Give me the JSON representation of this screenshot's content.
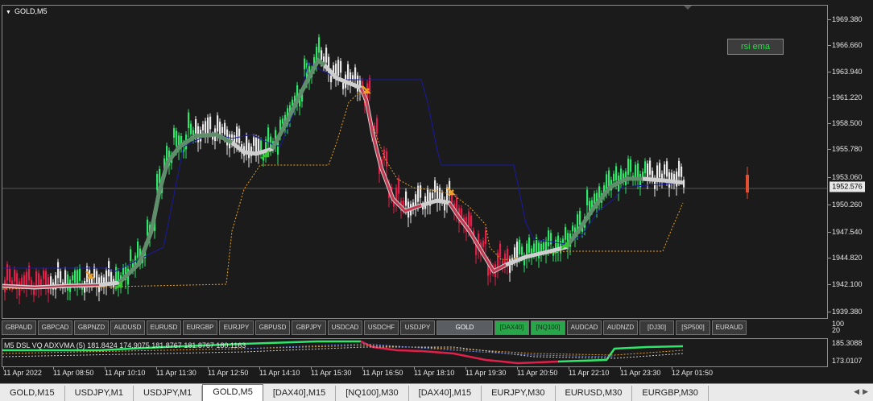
{
  "chart": {
    "title": "GOLD,M5",
    "collapse_icon": "triangle-down-icon",
    "current_price": "1952.576",
    "price_axis": [
      "1969.380",
      "1966.660",
      "1963.940",
      "1961.220",
      "1958.500",
      "1955.780",
      "1953.060",
      "1950.260",
      "1947.540",
      "1944.820",
      "1942.100",
      "1939.380"
    ],
    "rsi_ema_button": "rsi ema"
  },
  "symbols": [
    {
      "label": "GBPAUD",
      "state": "normal"
    },
    {
      "label": "GBPCAD",
      "state": "normal"
    },
    {
      "label": "GBPNZD",
      "state": "normal"
    },
    {
      "label": "AUDUSD",
      "state": "normal"
    },
    {
      "label": "EURUSD",
      "state": "normal"
    },
    {
      "label": "EURGBP",
      "state": "normal"
    },
    {
      "label": "EURJPY",
      "state": "normal"
    },
    {
      "label": "GBPUSD",
      "state": "normal"
    },
    {
      "label": "GBPJPY",
      "state": "normal"
    },
    {
      "label": "USDCAD",
      "state": "normal"
    },
    {
      "label": "USDCHF",
      "state": "normal"
    },
    {
      "label": "USDJPY",
      "state": "normal"
    },
    {
      "label": "GOLD",
      "state": "current"
    },
    {
      "label": "[DAX40]",
      "state": "green"
    },
    {
      "label": "[NQ100]",
      "state": "green"
    },
    {
      "label": "AUDCAD",
      "state": "normal"
    },
    {
      "label": "AUDNZD",
      "state": "normal"
    },
    {
      "label": "[DJ30]",
      "state": "normal"
    },
    {
      "label": "[SP500]",
      "state": "normal"
    },
    {
      "label": "EURAUD",
      "state": "normal"
    }
  ],
  "indicator": {
    "label": "M5 DSL  VQ  ADXVMA (5)   181.8424 174.9075 181.8767 181.8767 180.1163",
    "axis_top": [
      "100",
      "20"
    ],
    "axis": [
      "185.3088",
      "173.0107"
    ]
  },
  "time_axis": [
    "11 Apr 2022",
    "11 Apr 08:50",
    "11 Apr 10:10",
    "11 Apr 11:30",
    "11 Apr 12:50",
    "11 Apr 14:10",
    "11 Apr 15:30",
    "11 Apr 16:50",
    "11 Apr 18:10",
    "11 Apr 19:30",
    "11 Apr 20:50",
    "11 Apr 22:10",
    "11 Apr 23:30",
    "12 Apr 01:50"
  ],
  "tabs": [
    {
      "label": "GOLD,M15",
      "active": false
    },
    {
      "label": "USDJPY,M1",
      "active": false
    },
    {
      "label": "USDJPY,M1",
      "active": false
    },
    {
      "label": "GOLD,M5",
      "active": true
    },
    {
      "label": "[DAX40],M15",
      "active": false
    },
    {
      "label": "[NQ100],M30",
      "active": false
    },
    {
      "label": "[DAX40],M15",
      "active": false
    },
    {
      "label": "EURJPY,M30",
      "active": false
    },
    {
      "label": "EURUSD,M30",
      "active": false
    },
    {
      "label": "EURGBP,M30",
      "active": false
    }
  ],
  "tab_scroll": [
    "arrow-left-icon",
    "arrow-right-icon"
  ],
  "colors": {
    "bull": "#2ee66a",
    "bear": "#e0204a",
    "neutral": "#e8e8e8",
    "trail_green": "#5f8f6a",
    "trail_red": "#c23850",
    "dotted_orange": "#e8a020",
    "navy_line": "#1a1aa0",
    "buy_arrow": "#35c830",
    "sell_arrow": "#f0a020"
  }
}
